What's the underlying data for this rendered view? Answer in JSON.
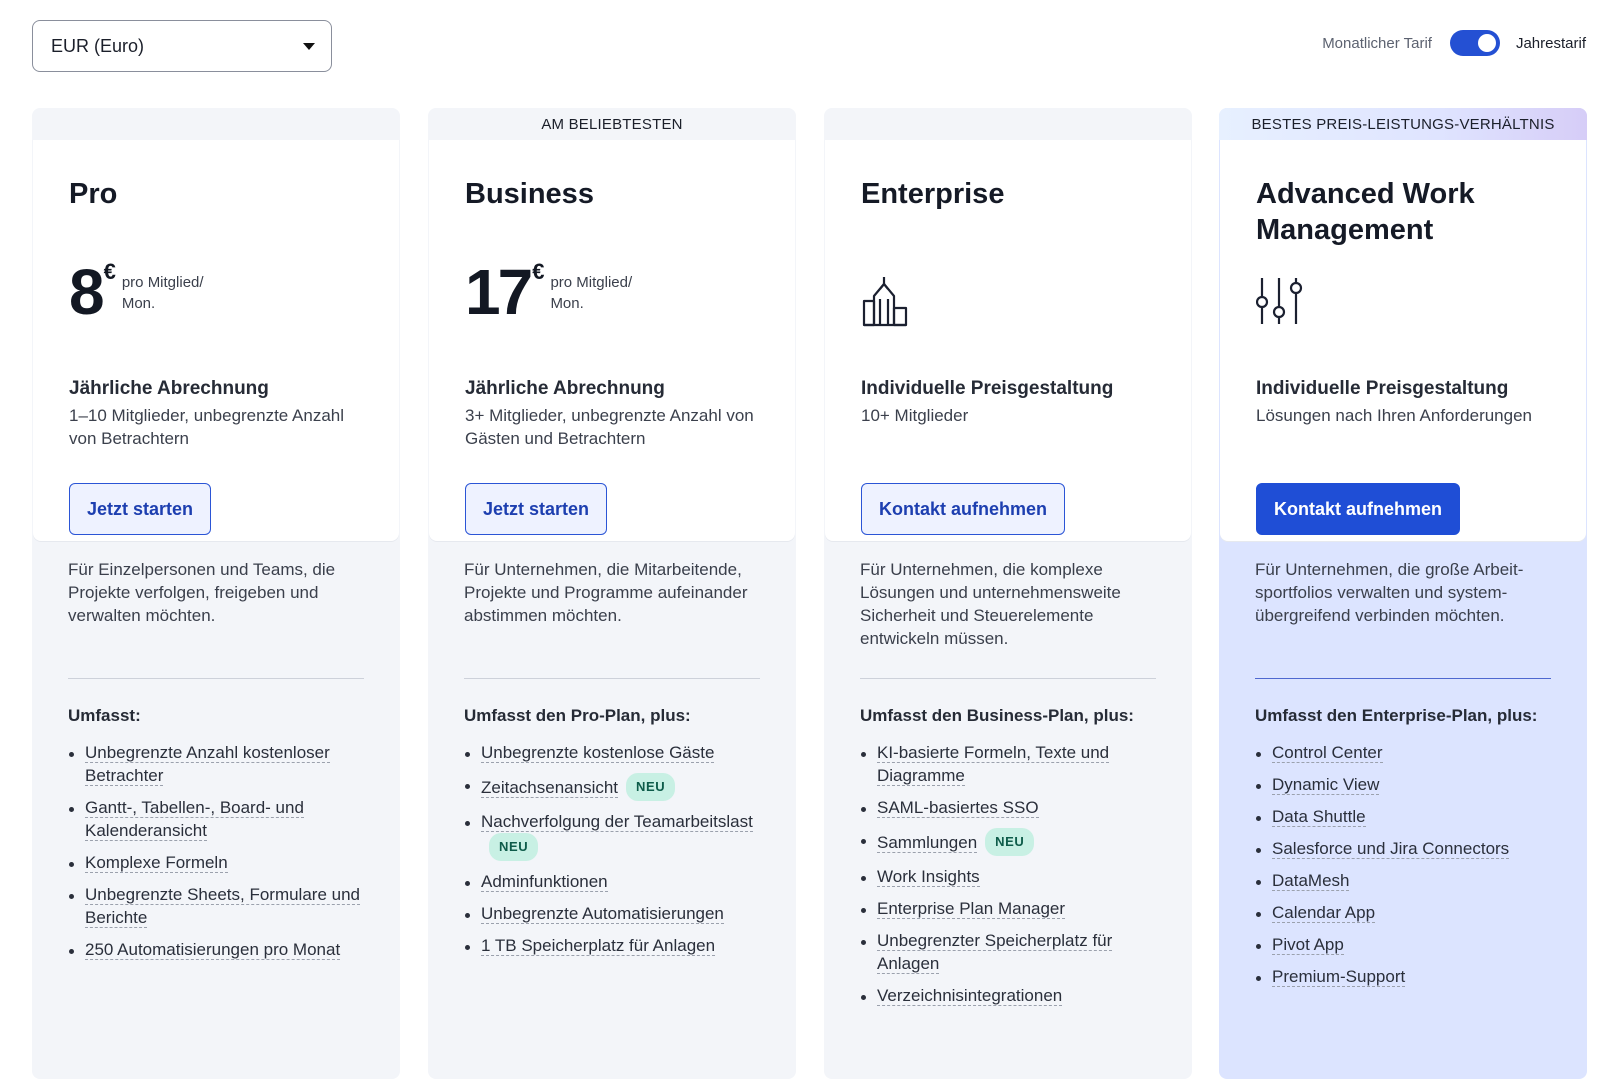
{
  "currency": {
    "selected": "EUR (Euro)"
  },
  "billing_toggle": {
    "monthly_label": "Monatlicher Tarif",
    "yearly_label": "Jahrestarif",
    "yearly_selected": true
  },
  "plans": [
    {
      "banner": "",
      "name": "Pro",
      "price": "8",
      "currency_symbol": "€",
      "price_unit_1": "pro Mitglied/",
      "price_unit_2": "Mon.",
      "billing_title": "Jährliche Abrechnung",
      "billing_desc": "1–10 Mitglieder, unbegrenzte Anzahl von Betrachtern",
      "cta": "Jetzt starten",
      "description": "Für Einzelpersonen und Teams, die Projekte verfolgen, freigeben und verwalten möchten.",
      "includes_label": "Umfasst:",
      "features": [
        {
          "text": "Unbegrenzte Anzahl kostenloser Betrachter",
          "badge": ""
        },
        {
          "text": "Gantt-, Tabellen-, Board- und Kalenderansicht",
          "badge": ""
        },
        {
          "text": "Komplexe Formeln",
          "badge": ""
        },
        {
          "text": "Unbegrenzte Sheets, Formulare und Berichte",
          "badge": ""
        },
        {
          "text": "250 Automatisierungen pro Monat",
          "badge": ""
        }
      ]
    },
    {
      "banner": "AM BELIEBTESTEN",
      "name": "Business",
      "price": "17",
      "currency_symbol": "€",
      "price_unit_1": "pro Mitglied/",
      "price_unit_2": "Mon.",
      "billing_title": "Jährliche Abrechnung",
      "billing_desc": "3+ Mitglieder, unbegrenzte Anzahl von Gästen und Betrachtern",
      "cta": "Jetzt starten",
      "description": "Für Unternehmen, die Mitarbeitende, Projekte und Programme aufeinander abstimmen möchten.",
      "includes_label": "Umfasst den Pro-Plan, plus:",
      "features": [
        {
          "text": "Unbegrenzte kostenlose Gäste",
          "badge": ""
        },
        {
          "text": "Zeitachsenansicht",
          "badge": "NEU"
        },
        {
          "text": "Nachverfolgung der Teamarbeitslast",
          "badge": "NEU"
        },
        {
          "text": "Adminfunktionen",
          "badge": ""
        },
        {
          "text": "Unbegrenzte Automatisierungen",
          "badge": ""
        },
        {
          "text": "1 TB Speicherplatz für Anlagen",
          "badge": ""
        }
      ]
    },
    {
      "banner": "",
      "name": "Enterprise",
      "icon": "buildings-icon",
      "billing_title": "Individuelle Preisgestaltung",
      "billing_desc": "10+ Mitglieder",
      "cta": "Kontakt aufnehmen",
      "description": "Für Unternehmen, die komplexe Lösungen und unternehmensweite Sicherheit und Steuerelemente entwickeln müssen.",
      "includes_label": "Umfasst den Business-Plan, plus:",
      "features": [
        {
          "text": "KI-basierte Formeln, Texte und Diagramme",
          "badge": ""
        },
        {
          "text": "SAML-basiertes SSO",
          "badge": ""
        },
        {
          "text": "Sammlungen",
          "badge": "NEU"
        },
        {
          "text": "Work Insights",
          "badge": ""
        },
        {
          "text": "Enterprise Plan Manager",
          "badge": ""
        },
        {
          "text": "Unbegrenzter Speicherplatz für Anlagen",
          "badge": ""
        },
        {
          "text": "Verzeichnisintegrationen",
          "badge": ""
        }
      ]
    },
    {
      "banner": "BESTES PREIS-LEISTUNGS-VERHÄLTNIS",
      "name": "Advanced Work Management",
      "icon": "sliders-icon",
      "billing_title": "Individuelle Preisgestaltung",
      "billing_desc": "Lösungen nach Ihren Anforderungen",
      "cta": "Kontakt aufnehmen",
      "description": "Für Unternehmen, die große Arbeit­sportfolios verwalten und system­übergreifend verbinden möchten.",
      "includes_label": "Umfasst den Enterprise-Plan, plus:",
      "features": [
        {
          "text": "Control Center",
          "badge": ""
        },
        {
          "text": "Dynamic View",
          "badge": ""
        },
        {
          "text": "Data Shuttle",
          "badge": ""
        },
        {
          "text": "Salesforce und Jira Connectors",
          "badge": ""
        },
        {
          "text": "DataMesh",
          "badge": ""
        },
        {
          "text": "Calendar App",
          "badge": ""
        },
        {
          "text": "Pivot App",
          "badge": ""
        },
        {
          "text": "Premium-Support",
          "badge": ""
        }
      ]
    }
  ]
}
